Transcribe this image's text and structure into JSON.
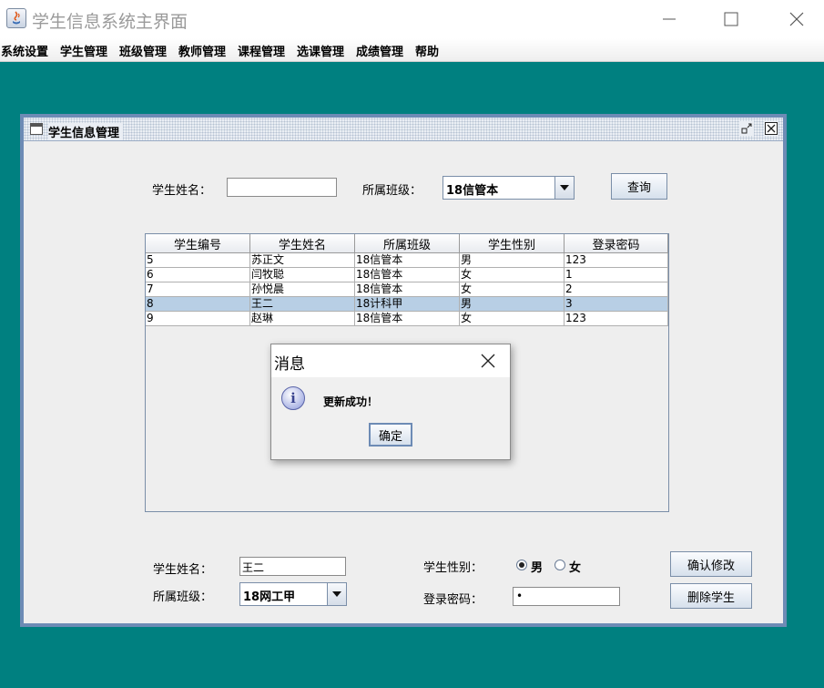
{
  "window": {
    "title": "学生信息系统主界面"
  },
  "menu": [
    "系统设置",
    "学生管理",
    "班级管理",
    "教师管理",
    "课程管理",
    "选课管理",
    "成绩管理",
    "帮助"
  ],
  "frame": {
    "title": "学生信息管理"
  },
  "search": {
    "name_label": "学生姓名：",
    "name_value": "",
    "class_label": "所属班级：",
    "class_value": "18信管本",
    "query_button": "查询"
  },
  "table": {
    "columns": [
      "学生编号",
      "学生姓名",
      "所属班级",
      "学生性别",
      "登录密码"
    ],
    "rows": [
      [
        "5",
        "苏正文",
        "18信管本",
        "男",
        "123"
      ],
      [
        "6",
        "闫牧聪",
        "18信管本",
        "女",
        "1"
      ],
      [
        "7",
        "孙悦晨",
        "18信管本",
        "女",
        "2"
      ],
      [
        "8",
        "王二",
        "18计科甲",
        "男",
        "3"
      ],
      [
        "9",
        "赵琳",
        "18信管本",
        "女",
        "123"
      ]
    ],
    "selected_row": 3
  },
  "dialog": {
    "title": "消息",
    "message": "更新成功！",
    "ok_button": "确定"
  },
  "edit": {
    "name_label": "学生姓名：",
    "name_value": "王二",
    "class_label": "所属班级：",
    "class_value": "18网工甲",
    "gender_label": "学生性别：",
    "gender_male": "男",
    "gender_female": "女",
    "gender_selected": "男",
    "password_label": "登录密码：",
    "password_value": "•",
    "confirm_button": "确认修改",
    "delete_button": "删除学生"
  }
}
